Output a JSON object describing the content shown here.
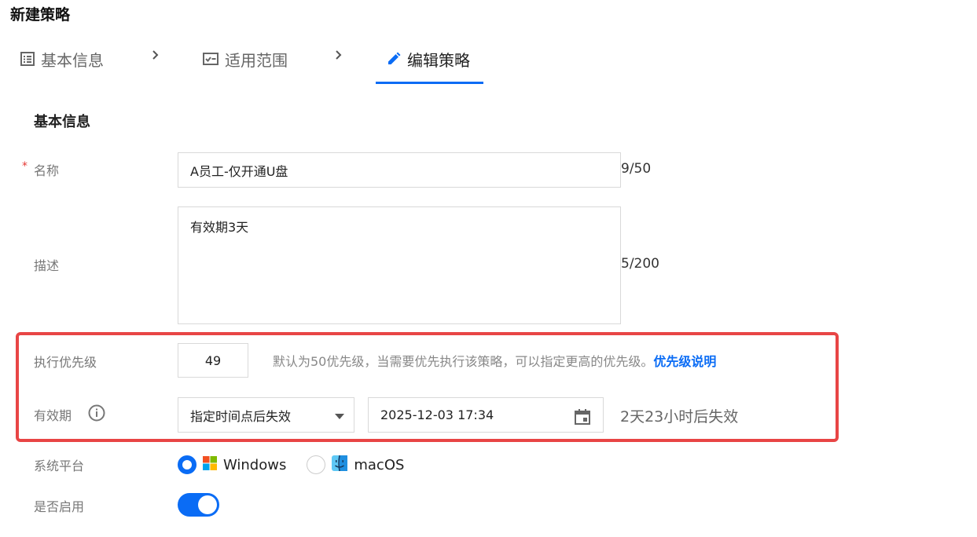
{
  "page_title": "新建策略",
  "steps": [
    {
      "label": "基本信息"
    },
    {
      "label": "适用范围"
    },
    {
      "label": "编辑策略"
    }
  ],
  "section_title": "基本信息",
  "form": {
    "name": {
      "label": "名称",
      "value": "A员工-仅开通U盘",
      "counter": "9/50"
    },
    "description": {
      "label": "描述",
      "value": "有效期3天",
      "counter": "5/200"
    },
    "priority": {
      "label": "执行优先级",
      "value": "49",
      "hint": "默认为50优先级，当需要优先执行该策略，可以指定更高的优先级。",
      "hint_link": "优先级说明"
    },
    "validity": {
      "label": "有效期",
      "mode": "指定时间点后失效",
      "datetime": "2025-12-03 17:34",
      "remaining": "2天23小时后失效"
    },
    "platform": {
      "label": "系统平台",
      "options": [
        {
          "label": "Windows",
          "selected": true
        },
        {
          "label": "macOS",
          "selected": false
        }
      ]
    },
    "enabled": {
      "label": "是否启用",
      "on": true
    }
  },
  "colors": {
    "accent": "#0a6cf5",
    "highlight": "#e84545",
    "required": "#e53935"
  }
}
